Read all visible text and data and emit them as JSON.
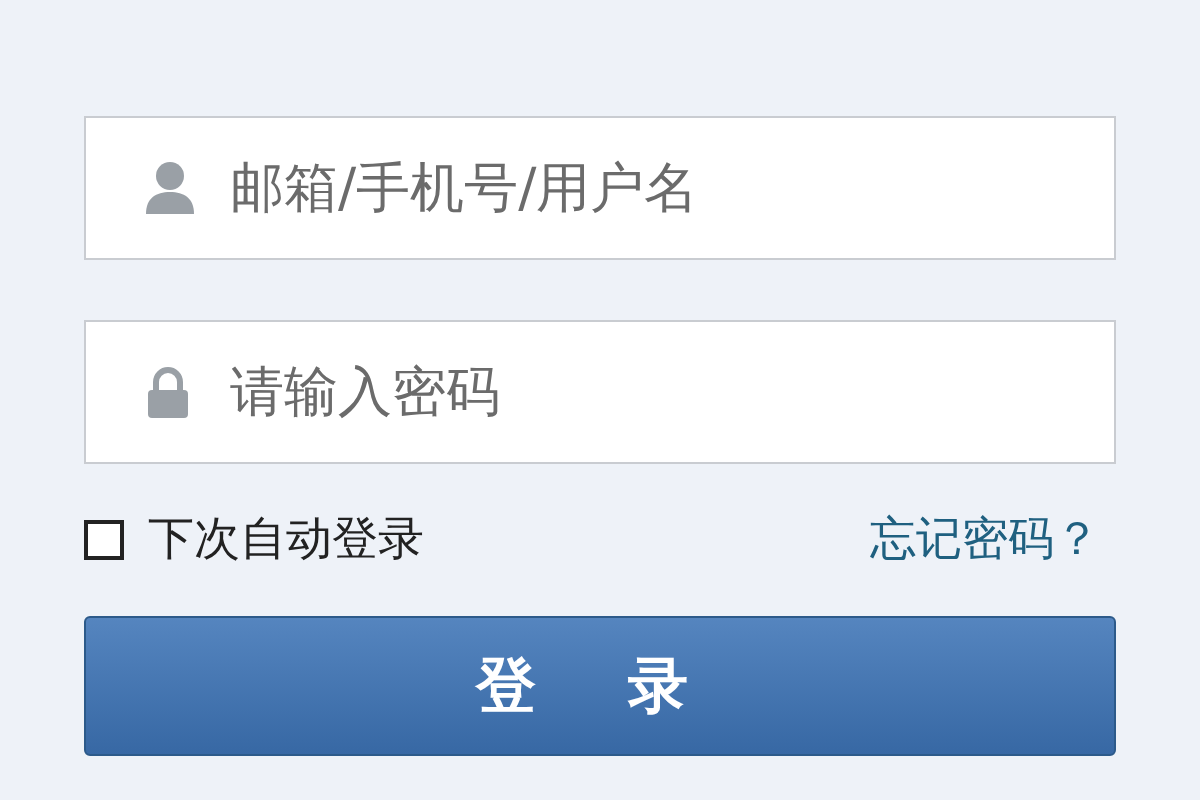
{
  "fields": [
    {
      "kind": "user",
      "placeholder": "邮箱/手机号/用户名"
    },
    {
      "kind": "password",
      "placeholder": "请输入密码"
    }
  ],
  "remember": {
    "label": "下次自动登录",
    "checked": false
  },
  "forgot_link": "忘记密码？",
  "login_button": "登 录"
}
